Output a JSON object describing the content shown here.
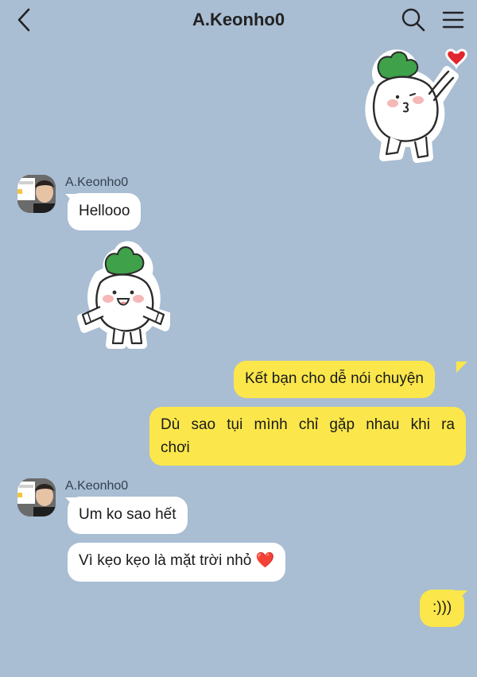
{
  "header": {
    "title": "A.Keonho0"
  },
  "messages": [
    {
      "type": "sticker",
      "direction": "out",
      "sticker": "radish-kiss-heart"
    },
    {
      "type": "text",
      "direction": "in",
      "sender": "A.Keonho0",
      "text": "Hellooo"
    },
    {
      "type": "sticker",
      "direction": "in",
      "sticker": "radish-wave"
    },
    {
      "type": "text",
      "direction": "out",
      "text": "Kết bạn cho dễ nói chuyện"
    },
    {
      "type": "text",
      "direction": "out",
      "line1": "Dù sao tụi mình chỉ gặp nhau khi ra",
      "line2": "chơi"
    },
    {
      "type": "text",
      "direction": "in",
      "sender": "A.Keonho0",
      "text": "Um ko sao hết"
    },
    {
      "type": "text",
      "direction": "in",
      "text": "Vì kẹo kẹo là mặt trời nhỏ",
      "emoji": "❤️"
    },
    {
      "type": "text",
      "direction": "out",
      "text": ":)))"
    }
  ],
  "colors": {
    "background": "#a9bdd3",
    "incoming_bubble": "#ffffff",
    "outgoing_bubble": "#fbe74b"
  },
  "icons": {
    "back": "chevron-left-icon",
    "search": "search-icon",
    "menu": "hamburger-menu-icon"
  }
}
